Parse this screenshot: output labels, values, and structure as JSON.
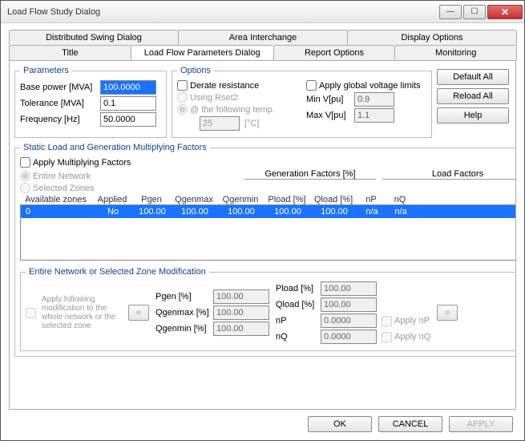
{
  "window": {
    "title": "Load Flow Study Dialog"
  },
  "tabs_row1": {
    "a": "Distributed Swing Dialog",
    "b": "Area Interchange",
    "c": "Display Options"
  },
  "tabs_row2": {
    "a": "Title",
    "b": "Load Flow Parameters Dialog",
    "c": "Report Options",
    "d": "Monitoring"
  },
  "params": {
    "legend": "Parameters",
    "base_lbl": "Base power [MVA]",
    "base_val": "100.0000",
    "tol_lbl": "Tolerance [MVA]",
    "tol_val": "0.1",
    "freq_lbl": "Frequency [Hz]",
    "freq_val": "50.0000"
  },
  "options": {
    "legend": "Options",
    "derate": "Derate resistance",
    "rset2": "Using Rset2",
    "following": "@ the following temp.",
    "temp_val": "25",
    "temp_unit": "[°C]",
    "applyglobal": "Apply global voltage limits",
    "minv_lbl": "Min V[pu]",
    "minv_val": "0.9",
    "maxv_lbl": "Max V[pu]",
    "maxv_val": "1.1"
  },
  "sidebtns": {
    "default": "Default All",
    "reload": "Reload All",
    "help": "Help"
  },
  "factors": {
    "legend": "Static Load and Generation Multiplying Factors",
    "apply": "Apply Multiplying Factors",
    "entire": "Entire Network",
    "zones": "Selected Zones",
    "group_gen": "Generation Factors [%]",
    "group_load": "Load Factors",
    "h_avail": "Available zones",
    "h_applied": "Applied",
    "h_pgen": "Pgen",
    "h_qgmax": "Qgenmax",
    "h_qgmin": "Qgenmin",
    "h_pl": "Pload [%]",
    "h_ql": "Qload [%]",
    "h_np": "nP",
    "h_nq": "nQ",
    "row": {
      "zone": "0",
      "applied": "No",
      "pgen": "100.00",
      "qgmax": "100.00",
      "qgmin": "100.00",
      "pl": "100.00",
      "ql": "100.00",
      "np": "n/a",
      "nq": "n/a"
    }
  },
  "mod": {
    "legend": "Entire Network or Selected Zone Modification",
    "hint": "Apply following modification to the whole network or the selected zone",
    "pgen_lbl": "Pgen [%]",
    "pgen_val": "100.00",
    "qgmax_lbl": "Qgenmax [%]",
    "qgmax_val": "100.00",
    "qgmin_lbl": "Qgenmin [%]",
    "qgmin_val": "100.00",
    "pl_lbl": "Pload [%]",
    "pl_val": "100.00",
    "ql_lbl": "Qload [%]",
    "ql_val": "100.00",
    "np_lbl": "nP",
    "np_val": "0.0000",
    "np_chk": "Apply nP",
    "nq_lbl": "nQ",
    "nq_val": "0.0000",
    "nq_chk": "Apply nQ"
  },
  "footer": {
    "ok": "OK",
    "cancel": "CANCEL",
    "apply": "APPLY"
  }
}
